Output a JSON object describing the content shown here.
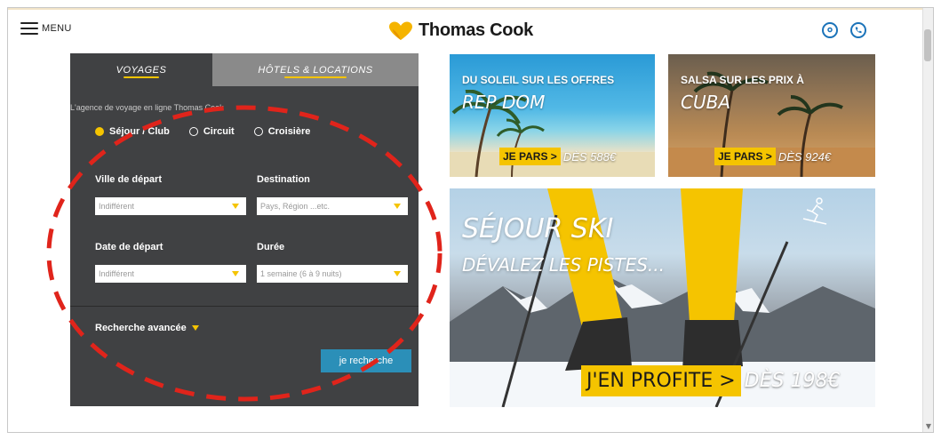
{
  "header": {
    "menu_label": "MENU",
    "brand": "Thomas Cook",
    "location_icon": "location-pin-icon",
    "phone_icon": "phone-icon"
  },
  "search": {
    "tabs": [
      {
        "label": "VOYAGES",
        "active": true
      },
      {
        "label": "HÔTELS & LOCATIONS",
        "active": false
      }
    ],
    "agency_text": "L'agence de voyage en ligne Thomas Cook",
    "trip_types": [
      {
        "label": "Séjour / Club",
        "selected": true
      },
      {
        "label": "Circuit",
        "selected": false
      },
      {
        "label": "Croisière",
        "selected": false
      }
    ],
    "departure_city": {
      "label": "Ville de départ",
      "value": "Indifférent"
    },
    "destination": {
      "label": "Destination",
      "placeholder": "Pays, Région ...etc."
    },
    "departure_date": {
      "label": "Date de départ",
      "value": "Indifférent"
    },
    "duration": {
      "label": "Durée",
      "value": "1 semaine (6 à 9 nuits)"
    },
    "advanced_label": "Recherche avancée",
    "submit_label": "je recherche"
  },
  "promos": {
    "rep_dom": {
      "title": "DU SOLEIL SUR LES OFFRES",
      "subtitle": "REP DOM",
      "cta": "JE PARS >",
      "price": "DÈS 588€"
    },
    "cuba": {
      "title": "SALSA SUR LES PRIX À",
      "subtitle": "CUBA",
      "cta": "JE PARS >",
      "price": "DÈS 924€"
    },
    "ski": {
      "title": "SÉJOUR SKI",
      "subtitle": "DÉVALEZ LES PISTES...",
      "cta": "J'EN PROFITE >",
      "price": "DÈS 198€"
    }
  },
  "colors": {
    "accent_yellow": "#f5c400",
    "panel_dark": "#404143",
    "button_blue": "#2b8fb8",
    "annotation_red": "#e0241b",
    "icon_blue": "#1b73b9"
  }
}
